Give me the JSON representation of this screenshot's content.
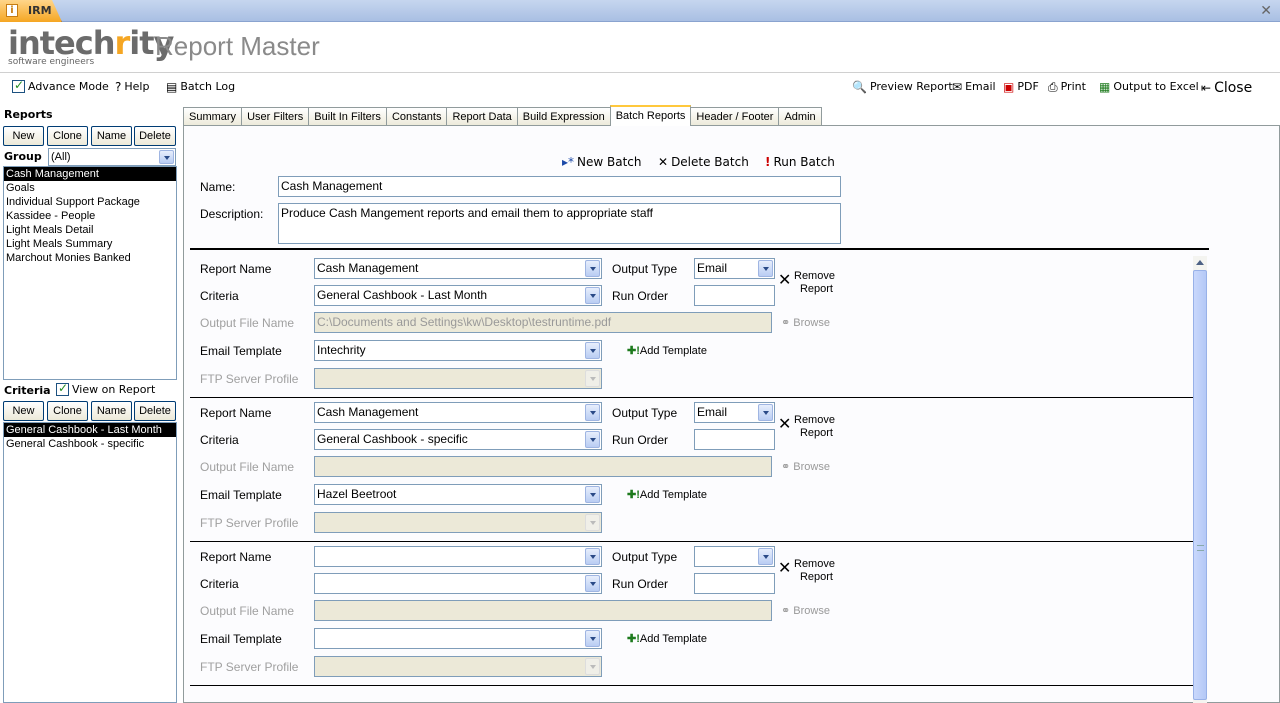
{
  "window": {
    "app_name": "IRM"
  },
  "brand": {
    "logo_text_pre": "intech",
    "logo_text_r": "r",
    "logo_text_post": "ity",
    "tagline": "software engineers",
    "product": "Report Master"
  },
  "toolbar": {
    "advance_mode": "Advance Mode",
    "help": "Help",
    "batch_log": "Batch Log",
    "preview_report": "Preview Report",
    "email": "Email",
    "pdf": "PDF",
    "print": "Print",
    "output_excel": "Output to Excel",
    "close": "Close"
  },
  "reports_panel": {
    "title": "Reports",
    "buttons": [
      "New",
      "Clone",
      "Name",
      "Delete"
    ],
    "group_label": "Group",
    "group_value": "(All)",
    "items": [
      "Cash Management",
      "Goals",
      "Individual Support Package",
      "Kassidee - People",
      "Light Meals Detail",
      "Light Meals Summary",
      "Marchout Monies Banked"
    ],
    "selected_index": 0
  },
  "criteria_panel": {
    "title": "Criteria",
    "view_on_report": "View on Report",
    "buttons": [
      "New",
      "Clone",
      "Name",
      "Delete"
    ],
    "items": [
      "General Cashbook - Last Month",
      "General Cashbook - specific"
    ],
    "selected_index": 0
  },
  "tabs": [
    "Summary",
    "User Filters",
    "Built In Filters",
    "Constants",
    "Report Data",
    "Build Expression",
    "Batch Reports",
    "Header / Footer",
    "Admin"
  ],
  "active_tab": "Batch Reports",
  "batch": {
    "new_batch": "New Batch",
    "delete_batch": "Delete Batch",
    "run_batch": "Run Batch",
    "name_label": "Name:",
    "name_value": "Cash Management",
    "desc_label": "Description:",
    "desc_value": "Produce Cash Mangement reports and email them to appropriate staff"
  },
  "labels": {
    "report_name": "Report Name",
    "criteria": "Criteria",
    "output_file_name": "Output File Name",
    "email_template": "Email Template",
    "ftp_server_profile": "FTP Server Profile",
    "output_type": "Output Type",
    "run_order": "Run Order",
    "remove_report_1": "Remove",
    "remove_report_2": "Report",
    "browse": "Browse",
    "add_template": "Add Template"
  },
  "rows": [
    {
      "report_name": "Cash Management",
      "criteria": "General Cashbook - Last Month",
      "output_file": "C:\\Documents and Settings\\kw\\Desktop\\testruntime.pdf",
      "email_template": "Intechrity",
      "ftp": "",
      "output_type": "Email",
      "run_order": ""
    },
    {
      "report_name": "Cash Management",
      "criteria": "General Cashbook - specific",
      "output_file": "",
      "email_template": "Hazel Beetroot",
      "ftp": "",
      "output_type": "Email",
      "run_order": ""
    },
    {
      "report_name": "",
      "criteria": "",
      "output_file": "",
      "email_template": "",
      "ftp": "",
      "output_type": "",
      "run_order": ""
    }
  ],
  "colors": {
    "accent_orange": "#f5a623",
    "selection": "#000000",
    "titlebar": "#b4c8ec",
    "tab_highlight": "#ffc83c"
  }
}
